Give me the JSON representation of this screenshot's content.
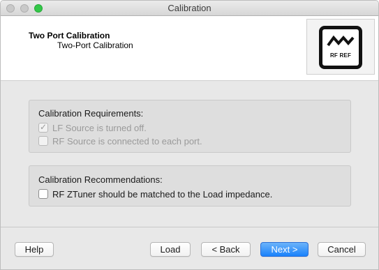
{
  "window": {
    "title": "Calibration"
  },
  "header": {
    "title": "Two Port Calibration",
    "subtitle": "Two-Port Calibration",
    "logo_text": "RF REF"
  },
  "requirements": {
    "title": "Calibration Requirements:",
    "items": [
      {
        "label": "LF Source is turned off.",
        "checked": true,
        "enabled": false
      },
      {
        "label": "RF Source is connected to each port.",
        "checked": false,
        "enabled": false
      }
    ]
  },
  "recommendations": {
    "title": "Calibration Recommendations:",
    "items": [
      {
        "label": "RF ZTuner should be matched to the Load impedance.",
        "checked": false,
        "enabled": true
      }
    ]
  },
  "buttons": {
    "help": "Help",
    "load": "Load",
    "back": "< Back",
    "next": "Next >",
    "cancel": "Cancel"
  },
  "colors": {
    "primary_button": "#1a82fb",
    "zoom_light": "#33c748"
  }
}
